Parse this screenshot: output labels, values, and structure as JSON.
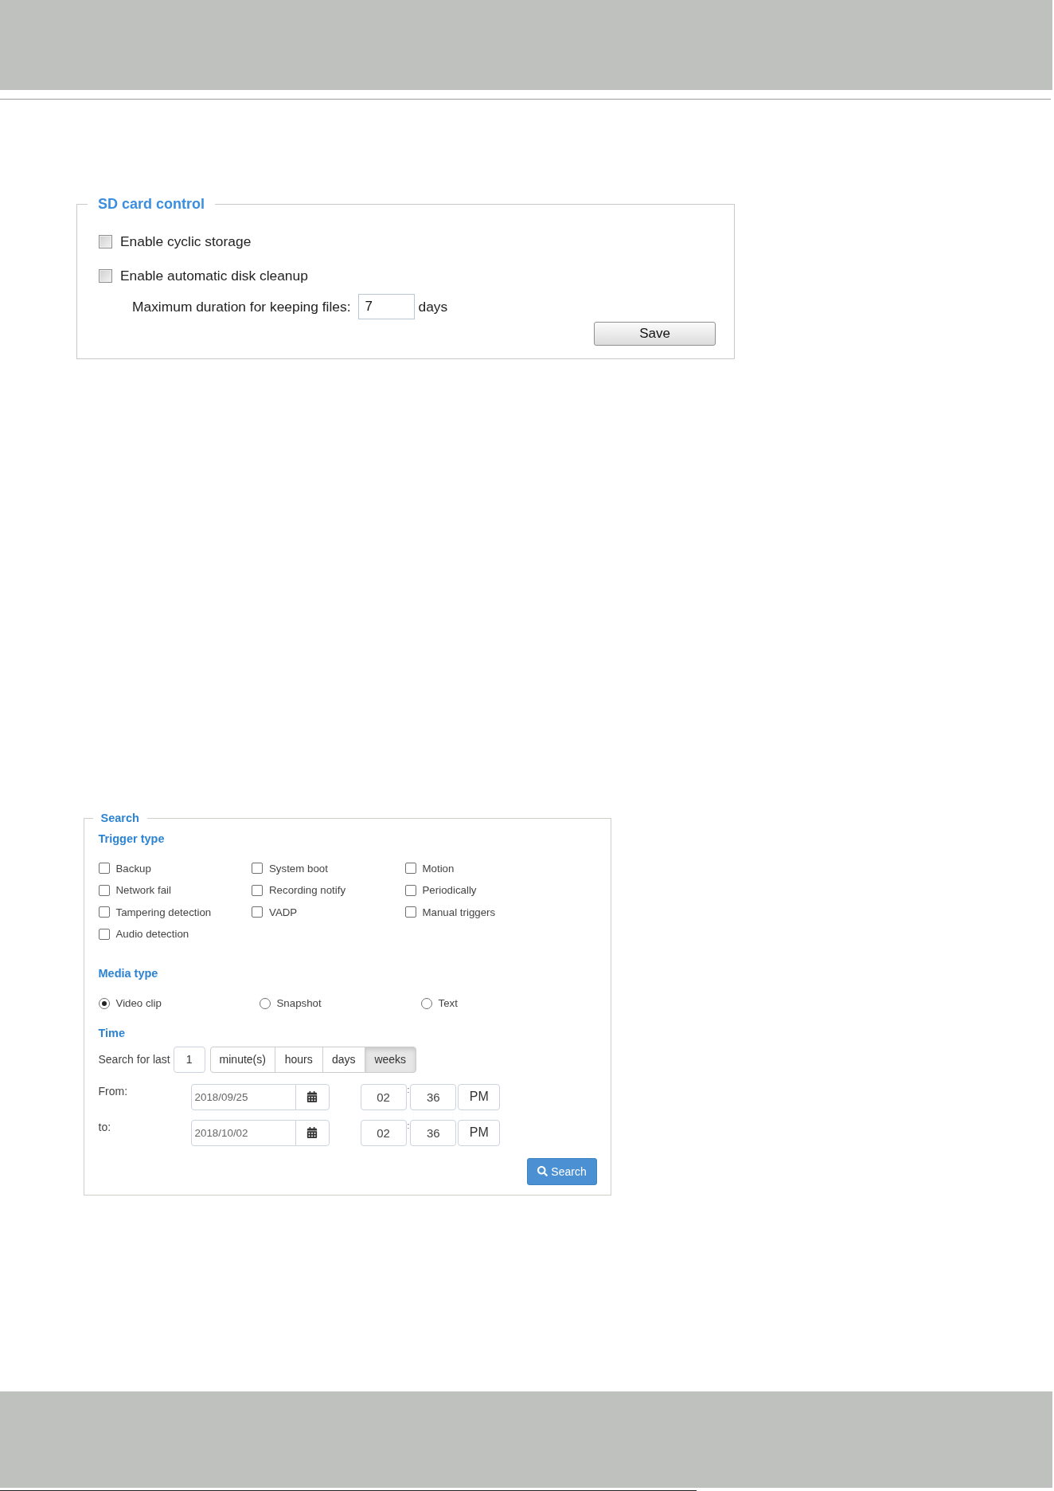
{
  "sd_card_control": {
    "title": "SD card control",
    "options": [
      {
        "label": "Enable cyclic storage",
        "checked": false
      },
      {
        "label": "Enable automatic disk cleanup",
        "checked": false
      }
    ],
    "duration": {
      "label": "Maximum duration for keeping files:",
      "value": "7",
      "unit": "days"
    },
    "save_button": "Save"
  },
  "search": {
    "title": "Search",
    "trigger_type": {
      "title": "Trigger type",
      "options": [
        {
          "label": "Backup",
          "checked": false
        },
        {
          "label": "System boot",
          "checked": false
        },
        {
          "label": "Motion",
          "checked": false
        },
        {
          "label": "Network fail",
          "checked": false
        },
        {
          "label": "Recording notify",
          "checked": false
        },
        {
          "label": "Periodically",
          "checked": false
        },
        {
          "label": "Tampering detection",
          "checked": false
        },
        {
          "label": "VADP",
          "checked": false
        },
        {
          "label": "Manual triggers",
          "checked": false
        },
        {
          "label": "Audio detection",
          "checked": false
        }
      ]
    },
    "media_type": {
      "title": "Media type",
      "options": [
        {
          "label": "Video clip",
          "selected": true
        },
        {
          "label": "Snapshot",
          "selected": false
        },
        {
          "label": "Text",
          "selected": false
        }
      ]
    },
    "time": {
      "title": "Time",
      "search_for_last": {
        "label": "Search for last",
        "value": "1",
        "units": [
          {
            "label": "minute(s)",
            "selected": false
          },
          {
            "label": "hours",
            "selected": false
          },
          {
            "label": "days",
            "selected": false
          },
          {
            "label": "weeks",
            "selected": true
          }
        ]
      },
      "ranges": [
        {
          "label": "From:",
          "date": "2018/09/25",
          "hour": "02",
          "separator": ":",
          "minute": "36",
          "period": "PM"
        },
        {
          "label": "to:",
          "date": "2018/10/02",
          "hour": "02",
          "separator": ":",
          "minute": "36",
          "period": "PM"
        }
      ]
    },
    "search_button": "Search"
  }
}
